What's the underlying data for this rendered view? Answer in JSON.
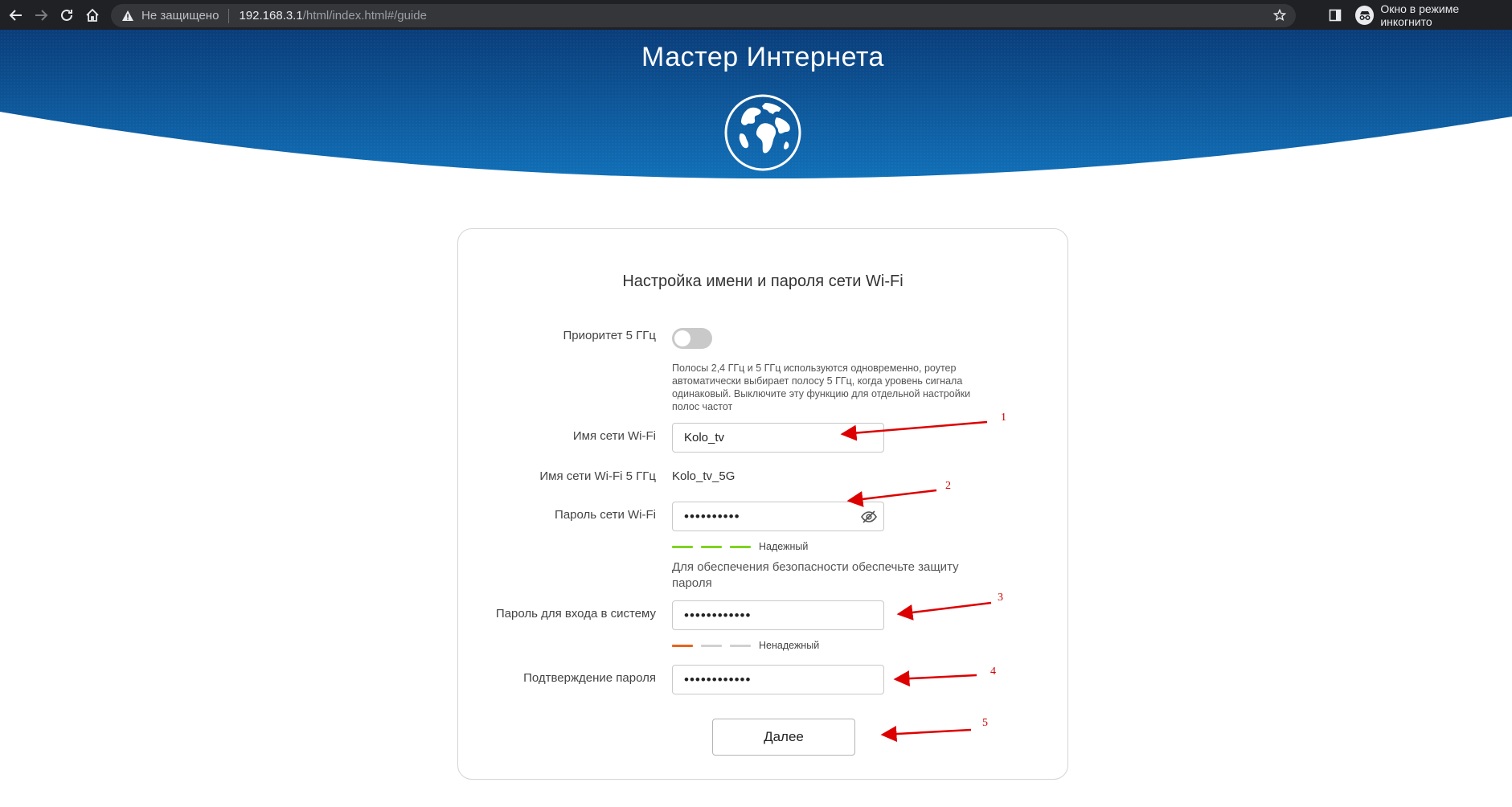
{
  "browser": {
    "security_label": "Не защищено",
    "url_host": "192.168.3.1",
    "url_path": "/html/index.html#/guide",
    "incognito_label": "Окно в режиме инкогнито",
    "icons": [
      "back-arrow-icon",
      "forward-arrow-icon",
      "reload-icon",
      "home-icon",
      "warning-icon",
      "star-icon",
      "side-panel-icon",
      "incognito-icon"
    ]
  },
  "banner": {
    "title": "Мастер Интернета",
    "icon": "globe-icon",
    "colors": {
      "top": "#0a3d7a",
      "bottom": "#1170b8"
    }
  },
  "card": {
    "title": "Настройка имени и пароля сети Wi-Fi",
    "priority": {
      "label": "Приоритет 5 ГГц",
      "enabled": false,
      "hint": "Полосы 2,4 ГГц и 5 ГГц используются одновременно, роутер автоматически выбирает полосу 5 ГГц, когда уровень сигнала одинаковый. Выключите эту функцию для отдельной настройки полос частот"
    },
    "wifi_name": {
      "label": "Имя сети Wi-Fi",
      "value": "Kolo_tv"
    },
    "wifi_name_5g": {
      "label": "Имя сети Wi-Fi 5 ГГц",
      "value": "Kolo_tv_5G"
    },
    "wifi_password": {
      "label": "Пароль сети Wi-Fi",
      "value": "••••••••••",
      "strength_label": "Надежный",
      "strength_level": 3,
      "strength_color": "#7ed321"
    },
    "security_note": "Для обеспечения безопасности обеспечьте защиту пароля",
    "login_password": {
      "label": "Пароль для входа в систему",
      "value": "••••••••••••",
      "strength_label": "Ненадежный",
      "strength_level": 1,
      "strength_color": "#e8641b"
    },
    "confirm_password": {
      "label": "Подтверждение пароля",
      "value": "••••••••••••"
    },
    "next_label": "Далее"
  },
  "annotations": {
    "color": "#dd0000",
    "numbers": [
      "1",
      "2",
      "3",
      "4",
      "5"
    ]
  }
}
